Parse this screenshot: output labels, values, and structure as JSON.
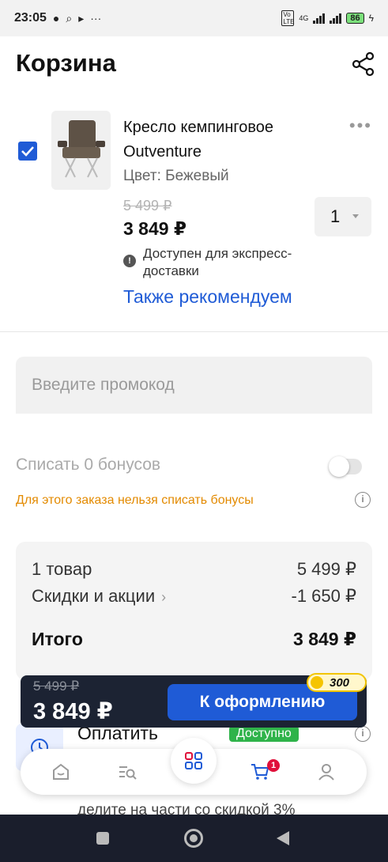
{
  "status_bar": {
    "time": "23:05",
    "network": "4G",
    "volte": "Vo LTE",
    "battery": "86"
  },
  "header": {
    "title": "Корзина"
  },
  "cart_item": {
    "checked": true,
    "name": "Кресло кемпинговое Outventure",
    "color_label": "Цвет: Бежевый",
    "old_price": "5 499 ₽",
    "price": "3 849 ₽",
    "quantity": "1",
    "express_note": "Доступен для экспресс-доставки",
    "recommend_link": "Также рекомендуем"
  },
  "promo": {
    "placeholder": "Введите промокод"
  },
  "bonuses": {
    "label": "Списать 0 бонусов",
    "enabled": false,
    "warning": "Для этого заказа нельзя списать бонусы"
  },
  "summary": {
    "items_label": "1 товар",
    "items_value": "5 499 ₽",
    "discounts_label": "Скидки и акции",
    "discounts_value": "-1 650 ₽",
    "total_label": "Итого",
    "total_value": "3 849 ₽"
  },
  "checkout": {
    "old_price": "5 499 ₽",
    "price": "3 849 ₽",
    "button_label": "К оформлению",
    "bonus_points": "300"
  },
  "pay_parts": {
    "title": "Оплатить",
    "badge": "Доступно",
    "subtitle": "делите на части со скидкой 3%"
  },
  "bottom_nav": {
    "cart_count": "1",
    "items": [
      "home",
      "catalog",
      "categories",
      "cart",
      "profile"
    ]
  },
  "colors": {
    "accent": "#1f5bd6",
    "warning": "#e38a00",
    "badge_red": "#e0103a",
    "success": "#2fb34a",
    "dark_bar": "#1c2333"
  }
}
